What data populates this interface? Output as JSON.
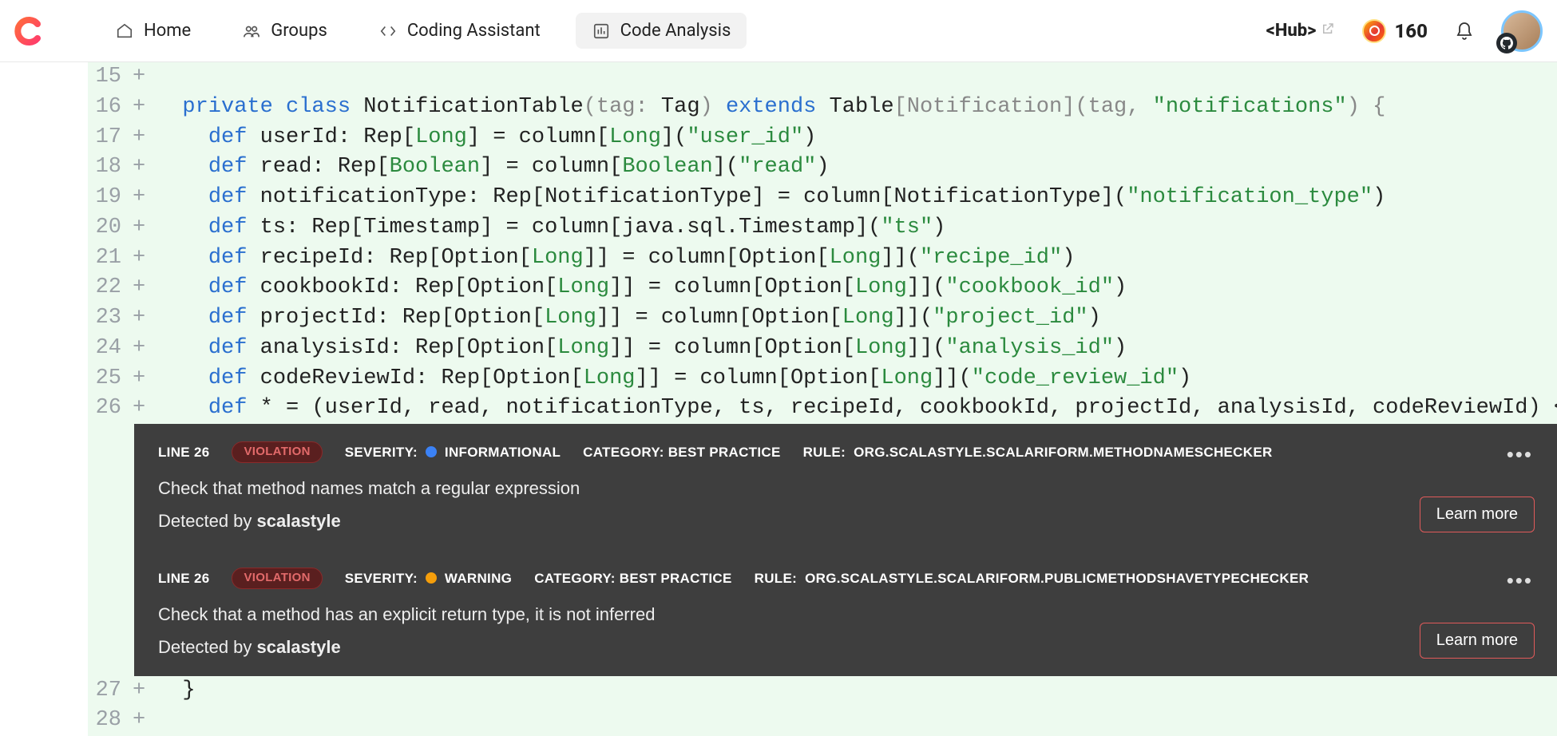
{
  "nav": {
    "home": "Home",
    "groups": "Groups",
    "assist": "Coding Assistant",
    "analysis": "Code Analysis"
  },
  "top": {
    "hub": "<Hub>",
    "points": "160"
  },
  "code": {
    "l15": "",
    "l16_private": "private",
    "l16_class": "class",
    "l16_name": " NotificationTable",
    "l16_extends": "extends",
    "l16_rest_a": "(tag",
    "l16_rest_b": ": ",
    "l16_tag": "Tag",
    "l16_rest_c": ") ",
    "l16_rest_d": " Table",
    "l16_rest_e": "[Notification](tag, ",
    "l16_str": "\"notifications\"",
    "l16_rest_f": ") {",
    "l17_def": "def",
    "l17_a": " userId: Rep[",
    "l17_long": "Long",
    "l17_b": "] = column[",
    "l17_c": "](",
    "l17_str": "\"user_id\"",
    "l17_d": ")",
    "l18_a": " read: Rep[",
    "l18_bool": "Boolean",
    "l18_b": "] = column[",
    "l18_c": "](",
    "l18_str": "\"read\"",
    "l18_d": ")",
    "l19_a": " notificationType: Rep[NotificationType] = column[NotificationType](",
    "l19_str": "\"notification_type\"",
    "l19_d": ")",
    "l20_a": " ts: Rep[Timestamp] = column[java.sql.Timestamp](",
    "l20_str": "\"ts\"",
    "l20_d": ")",
    "l21_a": " recipeId: Rep[Option[",
    "l21_b": "]] = column[Option[",
    "l21_c": "]](",
    "l21_str": "\"recipe_id\"",
    "l21_d": ")",
    "l22_a": " cookbookId: Rep[Option[",
    "l22_str": "\"cookbook_id\"",
    "l23_a": " projectId: Rep[Option[",
    "l23_str": "\"project_id\"",
    "l24_a": " analysisId: Rep[Option[",
    "l24_str": "\"analysis_id\"",
    "l25_a": " codeReviewId: Rep[Option[",
    "l25_str": "\"code_review_id\"",
    "l26_a": " * = (userId, read, notificationType, ts, recipeId, cookbookId, projectId, analysisId, codeReviewId) <> (Notifica",
    "l27": "}",
    "l28": ""
  },
  "viol1": {
    "line": "LINE 26",
    "badge": "VIOLATION",
    "sevlbl": "SEVERITY:",
    "sevval": "INFORMATIONAL",
    "catlbl": "CATEGORY: BEST PRACTICE",
    "rulelbl": "RULE:",
    "ruleval": "ORG.SCALASTYLE.SCALARIFORM.METHODNAMESCHECKER",
    "msg": "Check that method names match a regular expression",
    "det_a": "Detected by ",
    "det_b": "scalastyle",
    "learn": "Learn more"
  },
  "viol2": {
    "line": "LINE 26",
    "badge": "VIOLATION",
    "sevlbl": "SEVERITY:",
    "sevval": "WARNING",
    "catlbl": "CATEGORY: BEST PRACTICE",
    "rulelbl": "RULE:",
    "ruleval": "ORG.SCALASTYLE.SCALARIFORM.PUBLICMETHODSHAVETYPECHECKER",
    "msg": "Check that a method has an explicit return type, it is not inferred",
    "det_a": "Detected by ",
    "det_b": "scalastyle",
    "learn": "Learn more"
  },
  "lines": {
    "n15": "15",
    "n16": "16",
    "n17": "17",
    "n18": "18",
    "n19": "19",
    "n20": "20",
    "n21": "21",
    "n22": "22",
    "n23": "23",
    "n24": "24",
    "n25": "25",
    "n26": "26",
    "n27": "27",
    "n28": "28"
  },
  "plus": "+"
}
